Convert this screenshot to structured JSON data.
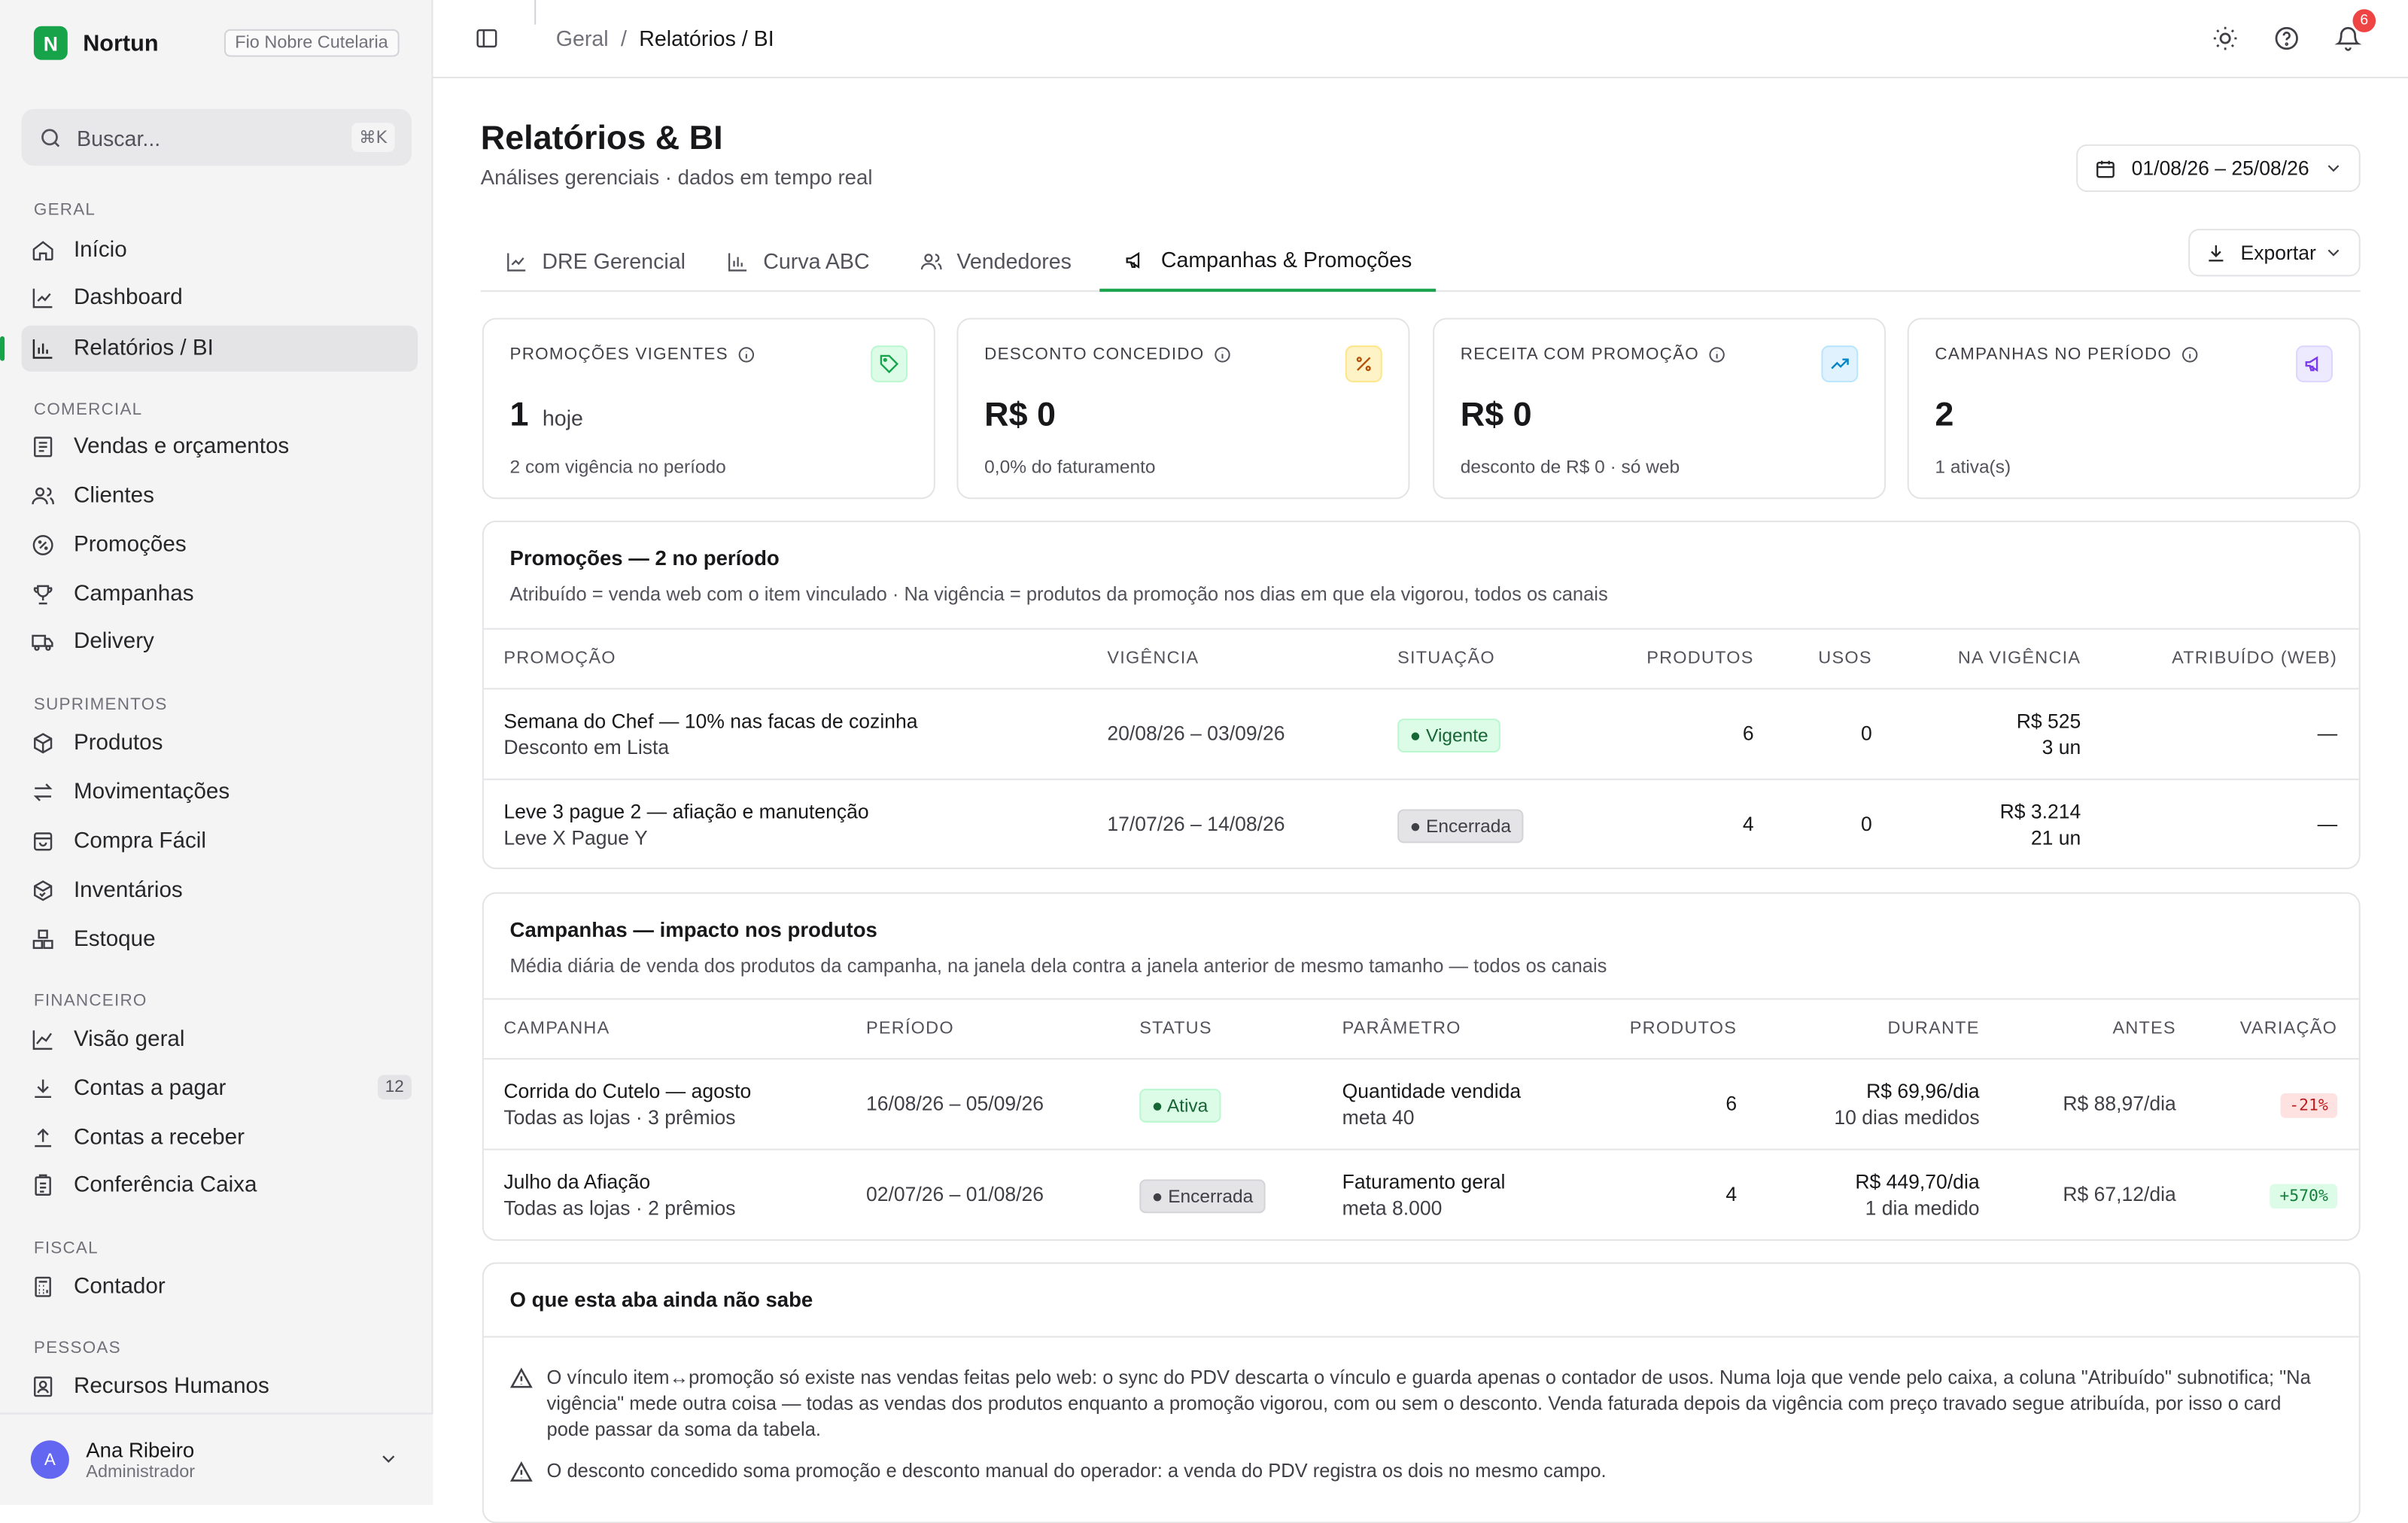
{
  "brand": {
    "logo_letter": "N",
    "name": "Nortun",
    "org": "Fio Nobre Cutelaria"
  },
  "search": {
    "placeholder": "Buscar...",
    "shortcut": "⌘K"
  },
  "sidebar": {
    "sections": [
      "GERAL",
      "COMERCIAL",
      "SUPRIMENTOS",
      "FINANCEIRO",
      "FISCAL",
      "PESSOAS"
    ],
    "items": [
      {
        "label": "Início",
        "icon": "home-icon"
      },
      {
        "label": "Dashboard",
        "icon": "line-chart-icon"
      },
      {
        "label": "Relatórios / BI",
        "icon": "bar-chart-icon"
      },
      {
        "label": "Vendas e orçamentos",
        "icon": "receipt-icon"
      },
      {
        "label": "Clientes",
        "icon": "users-icon"
      },
      {
        "label": "Promoções",
        "icon": "badge-percent-icon"
      },
      {
        "label": "Campanhas",
        "icon": "trophy-icon"
      },
      {
        "label": "Delivery",
        "icon": "truck-icon"
      },
      {
        "label": "Produtos",
        "icon": "box-icon"
      },
      {
        "label": "Movimentações",
        "icon": "arrows-icon"
      },
      {
        "label": "Compra Fácil",
        "icon": "shopping-bag-icon"
      },
      {
        "label": "Inventários",
        "icon": "package-check-icon"
      },
      {
        "label": "Estoque",
        "icon": "boxes-icon"
      },
      {
        "label": "Visão geral",
        "icon": "trend-icon"
      },
      {
        "label": "Contas a pagar",
        "icon": "download-icon",
        "count": "12"
      },
      {
        "label": "Contas a receber",
        "icon": "upload-icon"
      },
      {
        "label": "Conferência Caixa",
        "icon": "clipboard-icon"
      },
      {
        "label": "Contador",
        "icon": "calculator-icon"
      },
      {
        "label": "Recursos Humanos",
        "icon": "id-card-icon"
      }
    ]
  },
  "user": {
    "initial": "A",
    "name": "Ana Ribeiro",
    "role": "Administrador"
  },
  "topbar": {
    "breadcrumb": [
      "Geral",
      "/",
      "Relatórios / BI"
    ],
    "notifications": "6"
  },
  "page": {
    "title": "Relatórios & BI",
    "subtitle": "Análises gerenciais · dados em tempo real",
    "date_range": "01/08/26 – 25/08/26",
    "export_label": "Exportar"
  },
  "tabs": [
    "DRE Gerencial",
    "Curva ABC",
    "Vendedores",
    "Campanhas & Promoções"
  ],
  "kpis": [
    {
      "label": "PROMOÇÕES VIGENTES",
      "value": "1",
      "unit": "hoje",
      "sub": "2 com vigência no período",
      "icon": "tag-icon",
      "color": "#16a34a"
    },
    {
      "label": "DESCONTO CONCEDIDO",
      "value": "R$ 0",
      "unit": "",
      "sub": "0,0% do faturamento",
      "icon": "percent-icon",
      "color": "#ca8a04"
    },
    {
      "label": "RECEITA COM PROMOÇÃO",
      "value": "R$ 0",
      "unit": "",
      "sub": "desconto de R$ 0 · só web",
      "icon": "trending-up-icon",
      "color": "#0284c7"
    },
    {
      "label": "CAMPANHAS NO PERÍODO",
      "value": "2",
      "unit": "",
      "sub": "1 ativa(s)",
      "icon": "megaphone-icon",
      "color": "#7c3aed"
    }
  ],
  "promos": {
    "title": "Promoções — 2 no período",
    "desc": "Atribuído = venda web com o item vinculado · Na vigência = produtos da promoção nos dias em que ela vigorou, todos os canais",
    "headers": [
      "PROMOÇÃO",
      "VIGÊNCIA",
      "SITUAÇÃO",
      "PRODUTOS",
      "USOS",
      "NA VIGÊNCIA",
      "ATRIBUÍDO (WEB)"
    ],
    "rows": [
      {
        "name": "Semana do Chef — 10% nas facas de cozinha",
        "type": "Desconto em Lista",
        "period": "20/08/26 – 03/09/26",
        "status": "● Vigente",
        "products": "6",
        "uses": "0",
        "value": "R$ 525",
        "units": "3 un",
        "attributed": "—"
      },
      {
        "name": "Leve 3 pague 2 — afiação e manutenção",
        "type": "Leve X Pague Y",
        "period": "17/07/26 – 14/08/26",
        "status": "● Encerrada",
        "products": "4",
        "uses": "0",
        "value": "R$ 3.214",
        "units": "21 un",
        "attributed": "—"
      }
    ]
  },
  "campaigns": {
    "title": "Campanhas — impacto nos produtos",
    "desc": "Média diária de venda dos produtos da campanha, na janela dela contra a janela anterior de mesmo tamanho — todos os canais",
    "headers": [
      "CAMPANHA",
      "PERÍODO",
      "STATUS",
      "PARÂMETRO",
      "PRODUTOS",
      "DURANTE",
      "ANTES",
      "VARIAÇÃO"
    ],
    "rows": [
      {
        "name": "Corrida do Cutelo — agosto",
        "scope": "Todas as lojas · 3 prêmios",
        "period": "16/08/26 – 05/09/26",
        "status": "● Ativa",
        "param": "Quantidade vendida",
        "target": "meta 40",
        "products": "6",
        "during": "R$ 69,96/dia",
        "measured": "10 dias medidos",
        "before": "R$ 88,97/dia",
        "delta": "-21%"
      },
      {
        "name": "Julho da Afiação",
        "scope": "Todas as lojas · 2 prêmios",
        "period": "02/07/26 – 01/08/26",
        "status": "● Encerrada",
        "param": "Faturamento geral",
        "target": "meta 8.000",
        "products": "4",
        "during": "R$ 449,70/dia",
        "measured": "1 dia medido",
        "before": "R$ 67,12/dia",
        "delta": "+570%"
      }
    ]
  },
  "notes": {
    "title": "O que esta aba ainda não sabe",
    "items": [
      "O vínculo item↔promoção só existe nas vendas feitas pelo web: o sync do PDV descarta o vínculo e guarda apenas o contador de usos. Numa loja que vende pelo caixa, a coluna \"Atribuído\" subnotifica; \"Na vigência\" mede outra coisa — todas as vendas dos produtos enquanto a promoção vigorou, com ou sem o desconto. Venda faturada depois da vigência com preço travado segue atribuída, por isso o card pode passar da soma da tabela.",
      "O desconto concedido soma promoção e desconto manual do operador: a venda do PDV registra os dois no mesmo campo."
    ]
  }
}
